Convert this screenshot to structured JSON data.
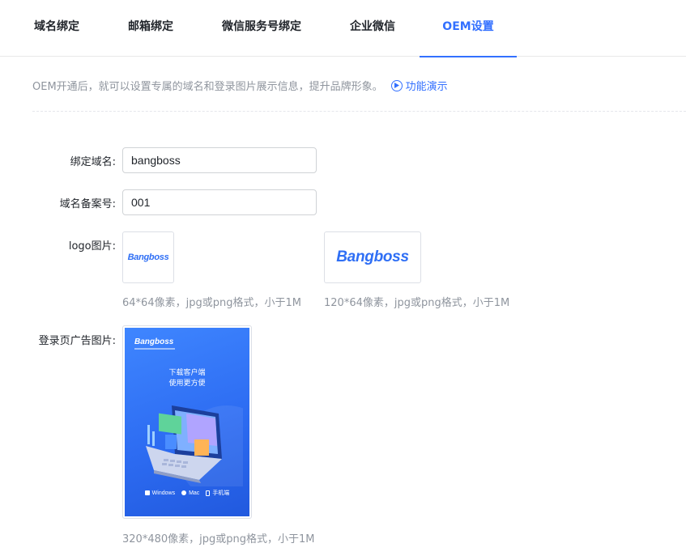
{
  "tabs": [
    {
      "label": "域名绑定"
    },
    {
      "label": "邮箱绑定"
    },
    {
      "label": "微信服务号绑定"
    },
    {
      "label": "企业微信"
    },
    {
      "label": "OEM设置",
      "active": true
    }
  ],
  "info": {
    "text": "OEM开通后，就可以设置专属的域名和登录图片展示信息，提升品牌形象。",
    "demo_label": "功能演示"
  },
  "form": {
    "domain": {
      "label": "绑定域名:",
      "value": "bangboss"
    },
    "icp": {
      "label": "域名备案号:",
      "value": "001"
    },
    "logo": {
      "label": "logo图片:",
      "small": {
        "logo_text": "Bangboss",
        "hint": "64*64像素，jpg或png格式，小于1M"
      },
      "large": {
        "logo_text": "Bangboss",
        "hint": "120*64像素，jpg或png格式，小于1M"
      }
    },
    "ad": {
      "label": "登录页广告图片:",
      "brand": "Bangboss",
      "line1": "下载客户端",
      "line2": "使用更方便",
      "footer": [
        "Windows",
        "Mac",
        "手机端"
      ],
      "hint": "320*480像素，jpg或png格式，小于1M"
    }
  },
  "colors": {
    "accent": "#3370ff",
    "muted": "#8f959e",
    "text": "#1f2329"
  }
}
